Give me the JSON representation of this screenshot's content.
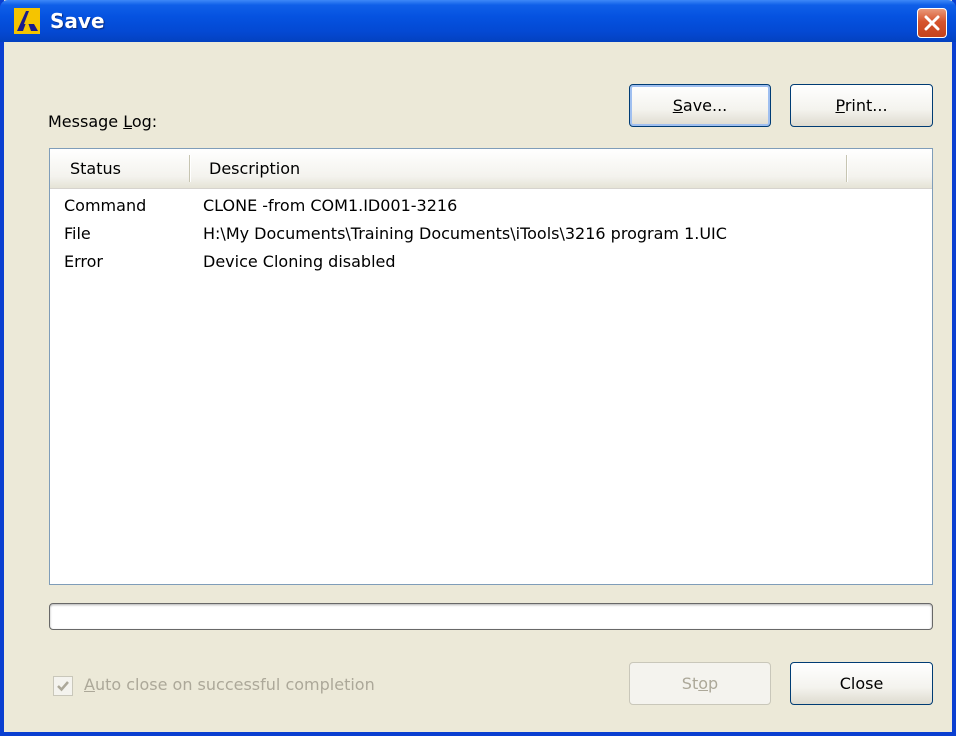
{
  "window": {
    "title": "Save",
    "title_bar_color": "#0552e0",
    "icon": "app-logo-icon",
    "close_icon": "close-icon"
  },
  "message_log": {
    "label_prefix": "Message ",
    "label_mnemonic": "L",
    "label_suffix": "og:",
    "columns": [
      "Status",
      "Description"
    ],
    "rows": [
      {
        "status": "Command",
        "description": "CLONE -from COM1.ID001-3216"
      },
      {
        "status": "File",
        "description": "H:\\My Documents\\Training Documents\\iTools\\3216 program 1.UIC"
      },
      {
        "status": "Error",
        "description": "Device Cloning disabled"
      }
    ]
  },
  "buttons": {
    "save": {
      "mnemonic": "S",
      "rest": "ave..."
    },
    "print": {
      "mnemonic": "P",
      "rest": "rint..."
    },
    "stop": {
      "before": "St",
      "mnemonic": "o",
      "after": "p"
    },
    "close": "Close"
  },
  "progress": {
    "value": 0,
    "fill_color": "#2fb54a"
  },
  "auto_close": {
    "checked": true,
    "enabled": false,
    "label_mnemonic": "A",
    "label_rest": "uto close on successful completion"
  }
}
